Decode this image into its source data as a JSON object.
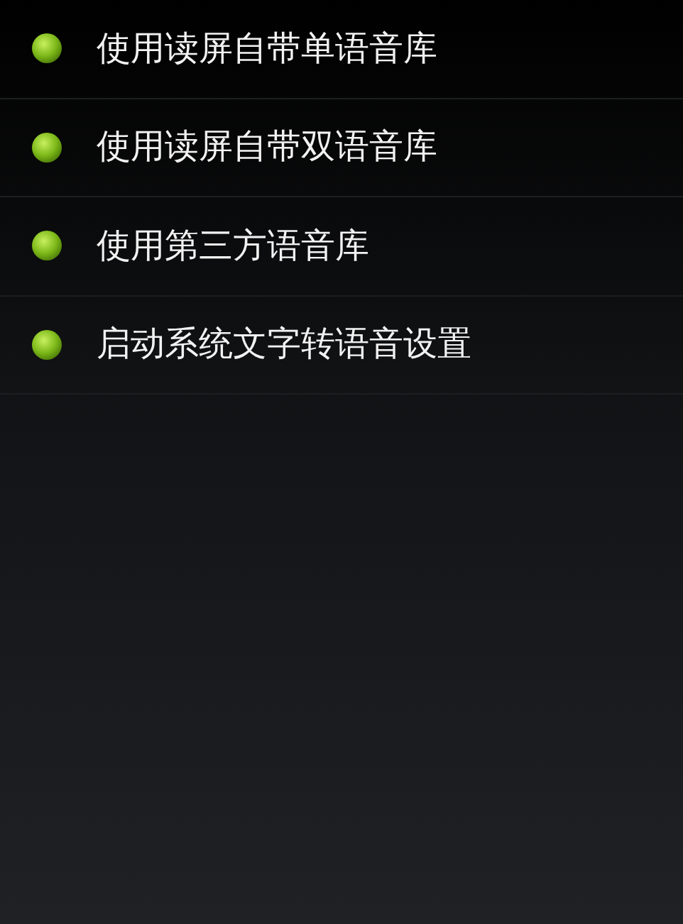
{
  "menu_items": [
    {
      "label": "使用读屏自带单语音库"
    },
    {
      "label": "使用读屏自带双语音库"
    },
    {
      "label": "使用第三方语音库"
    },
    {
      "label": "启动系统文字转语音设置"
    }
  ]
}
